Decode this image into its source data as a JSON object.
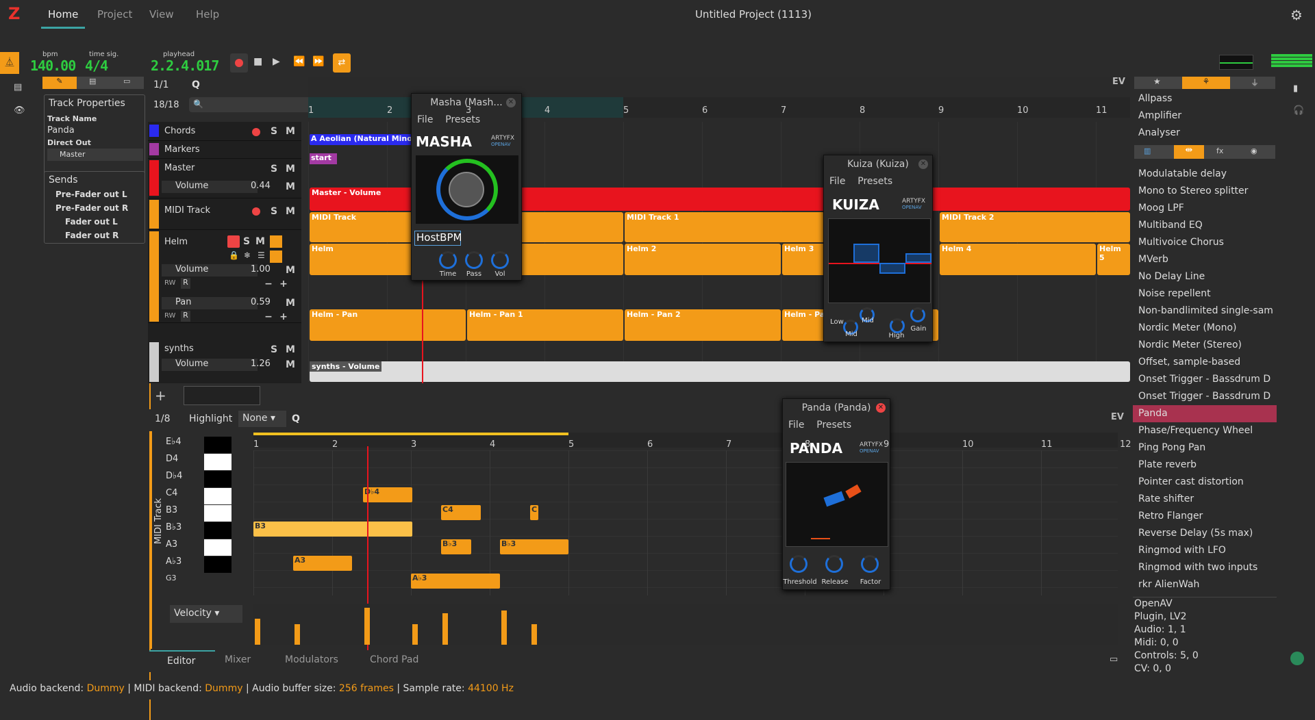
{
  "app": {
    "title": "Untitled Project (1113)",
    "tabs": [
      "Home",
      "Project",
      "View",
      "Help"
    ]
  },
  "transport": {
    "bpm": "140.00",
    "bpm_label": "bpm",
    "timesig": "4/4",
    "timesig_label": "time sig.",
    "playhead": "2.2.4.017",
    "playhead_label": "playhead"
  },
  "tracklist": {
    "snap": "1/1",
    "q": "Q",
    "count": "18/18",
    "ev": "EV"
  },
  "track_props": {
    "header": "Track Properties",
    "name_label": "Track Name",
    "name": "Panda",
    "direct_out_label": "Direct Out",
    "direct_out": "Master"
  },
  "sends": {
    "header": "Sends",
    "items": [
      "Pre-Fader out L",
      "Pre-Fader out R",
      "Fader out L",
      "Fader out R"
    ],
    "sup": "1"
  },
  "tracks": {
    "chords": "Chords",
    "markers": "Markers",
    "master": "Master",
    "master_volume_label": "Volume",
    "master_volume": "0.44",
    "midi": "MIDI Track",
    "helm": "Helm",
    "helm_volume_label": "Volume",
    "helm_volume": "1.00",
    "helm_pan_label": "Pan",
    "helm_pan": "0.59",
    "synths": "synths",
    "synths_volume_label": "Volume",
    "synths_volume": "1.26",
    "rw": "RW",
    "r": "R"
  },
  "timeline": {
    "bars": [
      "1",
      "2",
      "3",
      "4",
      "5",
      "6",
      "7",
      "8",
      "9",
      "10",
      "11"
    ],
    "chord_region": "A Aeolian (Natural Minor)",
    "marker": "start",
    "regions": {
      "master_vol": "Master - Volume",
      "midi": "MIDI Track",
      "midi1": "MIDI Track 1",
      "midi2": "MIDI Track 2",
      "helm": "Helm",
      "helm2": "Helm 2",
      "helm3": "Helm 3",
      "helm4": "Helm 4",
      "helm5": "Helm 5",
      "pan": "Helm - Pan",
      "pan1": "Helm - Pan 1",
      "pan2": "Helm - Pan 2",
      "pan3": "Helm - Pa",
      "synths_vol": "synths - Volume"
    }
  },
  "masha": {
    "title": "Masha (Mash...",
    "file": "File",
    "presets": "Presets",
    "logo": "MASHA",
    "brand": "ARTYFX",
    "brand2": "OPENAV",
    "field": "HostBPM",
    "knobs": [
      "Time",
      "Pass",
      "Vol"
    ]
  },
  "kuiza": {
    "title": "Kuiza (Kuiza)",
    "file": "File",
    "presets": "Presets",
    "logo": "KUIZA",
    "brand": "ARTYFX",
    "brand2": "OPENAV",
    "knobs": [
      "Low",
      "Mid",
      "Mid",
      "High",
      "Gain"
    ]
  },
  "panda": {
    "title": "Panda (Panda)",
    "file": "File",
    "presets": "Presets",
    "logo": "PANDA",
    "brand": "ARTYFX",
    "brand2": "OPENAV",
    "knobs": [
      "Threshold",
      "Release",
      "Factor"
    ]
  },
  "editor": {
    "snap": "1/8",
    "highlight_label": "Highlight",
    "highlight": "None",
    "q": "Q",
    "ev": "EV",
    "track": "MIDI Track",
    "bars": [
      "1",
      "2",
      "3",
      "4",
      "5",
      "6",
      "7",
      "8",
      "9",
      "10",
      "11",
      "12"
    ],
    "keys": [
      "E♭4",
      "D4",
      "D♭4",
      "C4",
      "B3",
      "B♭3",
      "A3",
      "A♭3",
      "G3"
    ],
    "notes": [
      "D♭4",
      "C4",
      "C",
      "B3",
      "B♭3",
      "B♭3",
      "A3",
      "A♭3"
    ],
    "velocity": "Velocity"
  },
  "bottom_tabs": [
    "Editor",
    "Mixer",
    "Modulators",
    "Chord Pad"
  ],
  "plugins": {
    "top": [
      "Allpass",
      "Amplifier",
      "Analyser"
    ],
    "list": [
      "Modulatable delay",
      "Mono to Stereo splitter",
      "Moog LPF",
      "Multiband EQ",
      "Multivoice Chorus",
      "MVerb",
      "No Delay Line",
      "Noise repellent",
      "Non-bandlimited single-sam",
      "Nordic Meter (Mono)",
      "Nordic Meter (Stereo)",
      "Offset, sample-based",
      "Onset Trigger - Bassdrum D",
      "Onset Trigger - Bassdrum D",
      "Panda",
      "Phase/Frequency Wheel",
      "Ping Pong Pan",
      "Plate reverb",
      "Pointer cast distortion",
      "Rate shifter",
      "Retro Flanger",
      "Reverse Delay (5s max)",
      "Ringmod with LFO",
      "Ringmod with two inputs",
      "rkr AlienWah"
    ],
    "selected": "Panda",
    "info": [
      "OpenAV",
      "Plugin, LV2",
      "Audio: 1, 1",
      "Midi: 0, 0",
      "Controls: 5, 0",
      "CV: 0, 0"
    ]
  },
  "status": {
    "a": "Audio backend: ",
    "a_val": "Dummy",
    "b": " | MIDI backend: ",
    "b_val": "Dummy",
    "c": " | Audio buffer size: ",
    "c_val": "256 frames",
    "d": " | Sample rate: ",
    "d_val": "44100 Hz"
  },
  "colors": {
    "accent": "#f39b18",
    "teal": "#3ca4a4",
    "red": "#e8141e",
    "lcd": "#2ecc40",
    "select": "#a8324f"
  }
}
